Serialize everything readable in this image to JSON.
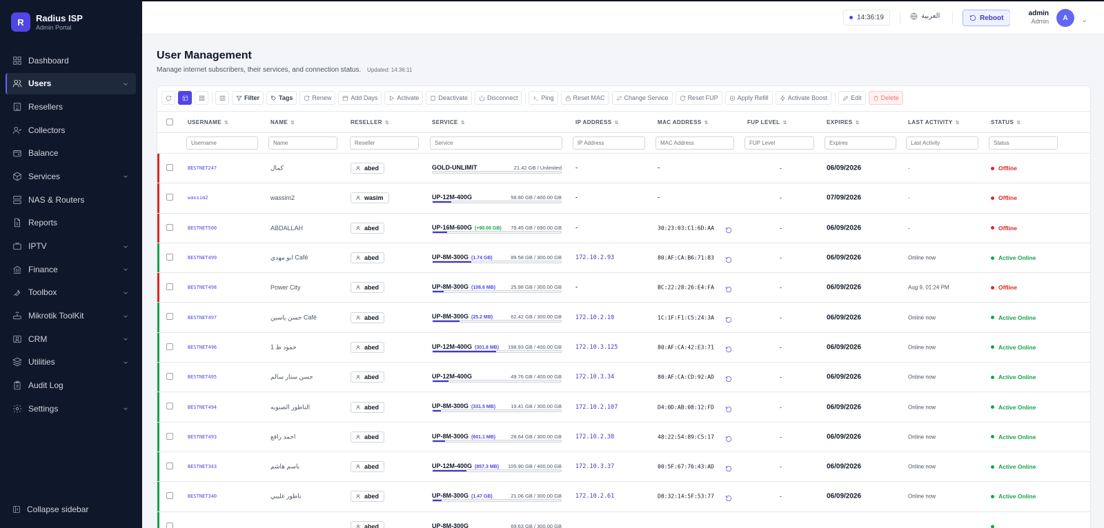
{
  "brand": {
    "logo_letter": "R",
    "title": "Radius ISP",
    "subtitle": "Admin Portal"
  },
  "sidebar": {
    "items": [
      {
        "label": "Dashboard",
        "icon": "grid-icon",
        "name": "dashboard",
        "has_chevron": false
      },
      {
        "label": "Users",
        "icon": "users-icon",
        "name": "users",
        "has_chevron": true,
        "active": true
      },
      {
        "label": "Resellers",
        "icon": "building-icon",
        "name": "resellers",
        "has_chevron": false
      },
      {
        "label": "Collectors",
        "icon": "user-check-icon",
        "name": "collectors",
        "has_chevron": false
      },
      {
        "label": "Balance",
        "icon": "wallet-icon",
        "name": "balance",
        "has_chevron": false
      },
      {
        "label": "Services",
        "icon": "package-icon",
        "name": "services",
        "has_chevron": true
      },
      {
        "label": "NAS & Routers",
        "icon": "server-icon",
        "name": "nas-routers",
        "has_chevron": false
      },
      {
        "label": "Reports",
        "icon": "file-icon",
        "name": "reports",
        "has_chevron": false
      },
      {
        "label": "IPTV",
        "icon": "tv-icon",
        "name": "iptv",
        "has_chevron": true
      },
      {
        "label": "Finance",
        "icon": "bank-icon",
        "name": "finance",
        "has_chevron": true
      },
      {
        "label": "Toolbox",
        "icon": "wrench-icon",
        "name": "toolbox",
        "has_chevron": true
      },
      {
        "label": "Mikrotik ToolKit",
        "icon": "router-icon",
        "name": "mikrotik-toolkit",
        "has_chevron": true
      },
      {
        "label": "CRM",
        "icon": "contact-icon",
        "name": "crm",
        "has_chevron": true
      },
      {
        "label": "Utilities",
        "icon": "layers-icon",
        "name": "utilities",
        "has_chevron": true
      },
      {
        "label": "Audit Log",
        "icon": "clipboard-icon",
        "name": "audit-log",
        "has_chevron": false
      },
      {
        "label": "Settings",
        "icon": "gear-icon",
        "name": "settings",
        "has_chevron": true
      }
    ],
    "collapse_label": "Collapse sidebar"
  },
  "header": {
    "clock": "14:36:19",
    "language": "العربية",
    "reboot_label": "Reboot",
    "user_name": "admin",
    "user_role": "Admin",
    "avatar_letter": "A"
  },
  "page": {
    "title": "User Management",
    "description": "Manage internet subscribers, their services, and connection status.",
    "updated": "Updated: 14:36:11"
  },
  "toolbar": {
    "filter": "Filter",
    "tags": "Tags",
    "renew": "Renew",
    "add_days": "Add Days",
    "activate": "Activate",
    "deactivate": "Deactivate",
    "disconnect": "Disconnect",
    "ping": "Ping",
    "reset_mac": "Reset MAC",
    "change_service": "Change Service",
    "reset_fup": "Reset FUP",
    "apply_refill": "Apply Refill",
    "activate_boost": "Activate Boost",
    "edit": "Edit",
    "delete": "Delete"
  },
  "table": {
    "columns": [
      "USERNAME",
      "NAME",
      "RESELLER",
      "SERVICE",
      "IP ADDRESS",
      "MAC ADDRESS",
      "FUP LEVEL",
      "EXPIRES",
      "LAST ACTIVITY",
      "STATUS"
    ],
    "filters": [
      "Username",
      "Name",
      "Reseller",
      "Service",
      "IP Address",
      "MAC Address",
      "FUP Level",
      "Expires",
      "Last Activity",
      "Status"
    ],
    "rows": [
      {
        "username": "BESTNET247",
        "name": "كمال",
        "reseller": "abed",
        "service": "GOLD-UNLIMIT",
        "extra": "",
        "extra_color": "blue",
        "usage": "21.42 GB / Unlimited",
        "fill": 0.0,
        "ip": "-",
        "mac": "-",
        "mac_reset": false,
        "fup": "-",
        "expires": "06/09/2026",
        "last": "-",
        "status": "Offline",
        "online": false
      },
      {
        "username": "wassim2",
        "name": "wassim2",
        "reseller": "wasim",
        "service": "UP-12M-400G",
        "extra": "",
        "extra_color": "blue",
        "usage": "58.80 GB / 400.00 GB",
        "fill": 0.147,
        "ip": "-",
        "mac": "-",
        "mac_reset": false,
        "fup": "-",
        "expires": "07/09/2026",
        "last": "-",
        "status": "Offline",
        "online": false
      },
      {
        "username": "BESTNET500",
        "name": "ABDALLAH",
        "reseller": "abed",
        "service": "UP-16M-600G",
        "extra": "(+90.00 GB)",
        "extra_color": "green",
        "usage": "79.45 GB / 690.00 GB",
        "fill": 0.115,
        "ip": "-",
        "mac": "30:23:03:C1:6D:AA",
        "mac_reset": true,
        "fup": "-",
        "expires": "06/09/2026",
        "last": "-",
        "status": "Offline",
        "online": false
      },
      {
        "username": "BESTNET499",
        "name": "ابو مهدي Café",
        "reseller": "abed",
        "service": "UP-8M-300G",
        "extra": "(1.74 GB)",
        "extra_color": "blue",
        "usage": "89.58 GB / 300.00 GB",
        "fill": 0.299,
        "ip": "172.10.2.93",
        "mac": "80:AF:CA:B6:71:83",
        "mac_reset": true,
        "fup": "-",
        "expires": "06/09/2026",
        "last": "Online now",
        "status": "Active Online",
        "online": true
      },
      {
        "username": "BESTNET498",
        "name": "Power City",
        "reseller": "abed",
        "service": "UP-8M-300G",
        "extra": "(108.6 MB)",
        "extra_color": "blue",
        "usage": "25.98 GB / 300.00 GB",
        "fill": 0.087,
        "ip": "-",
        "mac": "BC:22:28:26:E4:FA",
        "mac_reset": true,
        "fup": "-",
        "expires": "06/09/2026",
        "last": "Aug 9, 01:24 PM",
        "status": "Offline",
        "online": false
      },
      {
        "username": "BESTNET497",
        "name": "حسن ياسين Café",
        "reseller": "abed",
        "service": "UP-8M-300G",
        "extra": "(25.2 MB)",
        "extra_color": "blue",
        "usage": "62.42 GB / 300.00 GB",
        "fill": 0.208,
        "ip": "172.10.2.10",
        "mac": "1C:1F:F1:C5:24:3A",
        "mac_reset": true,
        "fup": "-",
        "expires": "06/09/2026",
        "last": "Online now",
        "status": "Active Online",
        "online": true
      },
      {
        "username": "BESTNET496",
        "name": "حمود ط 1",
        "reseller": "abed",
        "service": "UP-12M-400G",
        "extra": "(301.8 MB)",
        "extra_color": "blue",
        "usage": "198.93 GB / 400.00 GB",
        "fill": 0.497,
        "ip": "172.10.3.125",
        "mac": "80:AF:CA:42:E3:71",
        "mac_reset": true,
        "fup": "-",
        "expires": "06/09/2026",
        "last": "Online now",
        "status": "Active Online",
        "online": true
      },
      {
        "username": "BESTNET495",
        "name": "حسن ستار سالم",
        "reseller": "abed",
        "service": "UP-12M-400G",
        "extra": "",
        "extra_color": "blue",
        "usage": "49.76 GB / 400.00 GB",
        "fill": 0.124,
        "ip": "172.10.3.34",
        "mac": "80:AF:CA:CD:92:AD",
        "mac_reset": true,
        "fup": "-",
        "expires": "06/09/2026",
        "last": "Online now",
        "status": "Active Online",
        "online": true
      },
      {
        "username": "BESTNET494",
        "name": "الناطور الصنوبه",
        "reseller": "abed",
        "service": "UP-8M-300G",
        "extra": "(331.5 MB)",
        "extra_color": "blue",
        "usage": "19.41 GB / 300.00 GB",
        "fill": 0.065,
        "ip": "172.10.2.107",
        "mac": "D4:0D:AB:08:12:FD",
        "mac_reset": true,
        "fup": "-",
        "expires": "06/09/2026",
        "last": "Online now",
        "status": "Active Online",
        "online": true
      },
      {
        "username": "BESTNET493",
        "name": "احمد رافع",
        "reseller": "abed",
        "service": "UP-8M-300G",
        "extra": "(601.1 MB)",
        "extra_color": "blue",
        "usage": "28.64 GB / 300.00 GB",
        "fill": 0.095,
        "ip": "172.10.2.38",
        "mac": "48:22:54:89:C5:17",
        "mac_reset": true,
        "fup": "-",
        "expires": "06/09/2026",
        "last": "Online now",
        "status": "Active Online",
        "online": true
      },
      {
        "username": "BESTNET343",
        "name": "باسم هاشم",
        "reseller": "abed",
        "service": "UP-12M-400G",
        "extra": "(857.3 MB)",
        "extra_color": "blue",
        "usage": "105.90 GB / 400.00 GB",
        "fill": 0.265,
        "ip": "172.10.3.37",
        "mac": "00:5F:67:76:43:AD",
        "mac_reset": true,
        "fup": "-",
        "expires": "06/09/2026",
        "last": "Online now",
        "status": "Active Online",
        "online": true
      },
      {
        "username": "BESTNET340",
        "name": "ناطور غليبي",
        "reseller": "abed",
        "service": "UP-8M-300G",
        "extra": "(1.47 GB)",
        "extra_color": "blue",
        "usage": "21.06 GB / 300.00 GB",
        "fill": 0.07,
        "ip": "172.10.2.61",
        "mac": "D8:32:14:5F:53:77",
        "mac_reset": true,
        "fup": "-",
        "expires": "06/09/2026",
        "last": "Online now",
        "status": "Active Online",
        "online": true
      },
      {
        "username": "",
        "name": "",
        "reseller": "abed",
        "service": "UP-8M-300G",
        "extra": "",
        "extra_color": "blue",
        "usage": "69.63 GB / 300.00 GB",
        "fill": 0.232,
        "ip": "",
        "mac": "",
        "mac_reset": false,
        "fup": "",
        "expires": "",
        "last": "",
        "status": "",
        "online": true
      }
    ]
  },
  "colors": {
    "accent": "#4f46e5",
    "offline": "#dc2626",
    "online": "#16a34a",
    "sidebar_bg": "#0f172a"
  }
}
